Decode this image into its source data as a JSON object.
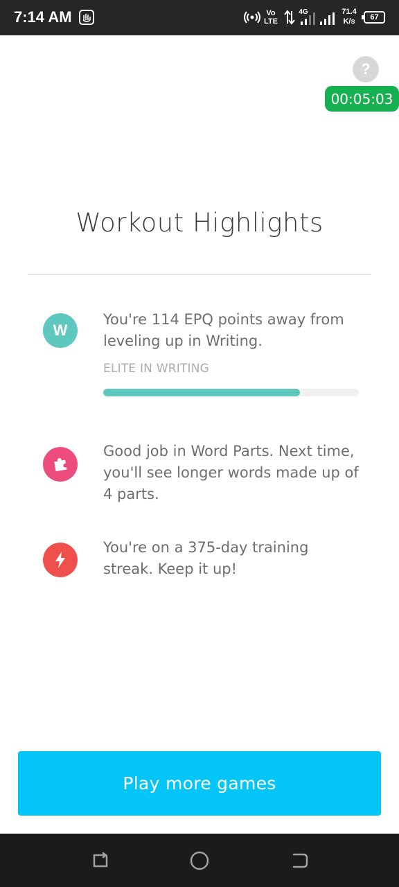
{
  "status_bar": {
    "time": "7:14 AM",
    "network_speed_value": "71.4",
    "network_speed_unit": "K/s",
    "battery": "67",
    "volte_top": "Vo",
    "volte_bottom": "LTE",
    "network_type": "4G"
  },
  "header": {
    "help_label": "?",
    "timer": "00:05:03"
  },
  "main": {
    "title": "Workout Highlights",
    "highlights": [
      {
        "icon_letter": "W",
        "icon_color": "#5ec8be",
        "text": "You're 114 EPQ points away from leveling up in Writing.",
        "level_label": "ELITE IN WRITING",
        "progress": 0.77
      },
      {
        "icon": "puzzle-icon",
        "icon_color": "#ec4d7c",
        "text": "Good job in Word Parts. Next time, you'll see longer words made up of 4 parts."
      },
      {
        "icon": "lightning-icon",
        "icon_color": "#f0504b",
        "text": "You're on a 375-day training streak. Keep it up!"
      }
    ]
  },
  "footer": {
    "play_button_label": "Play more games"
  },
  "nav": {
    "recent_icon": "recent-apps-icon",
    "home_icon": "home-icon",
    "back_icon": "back-icon"
  }
}
